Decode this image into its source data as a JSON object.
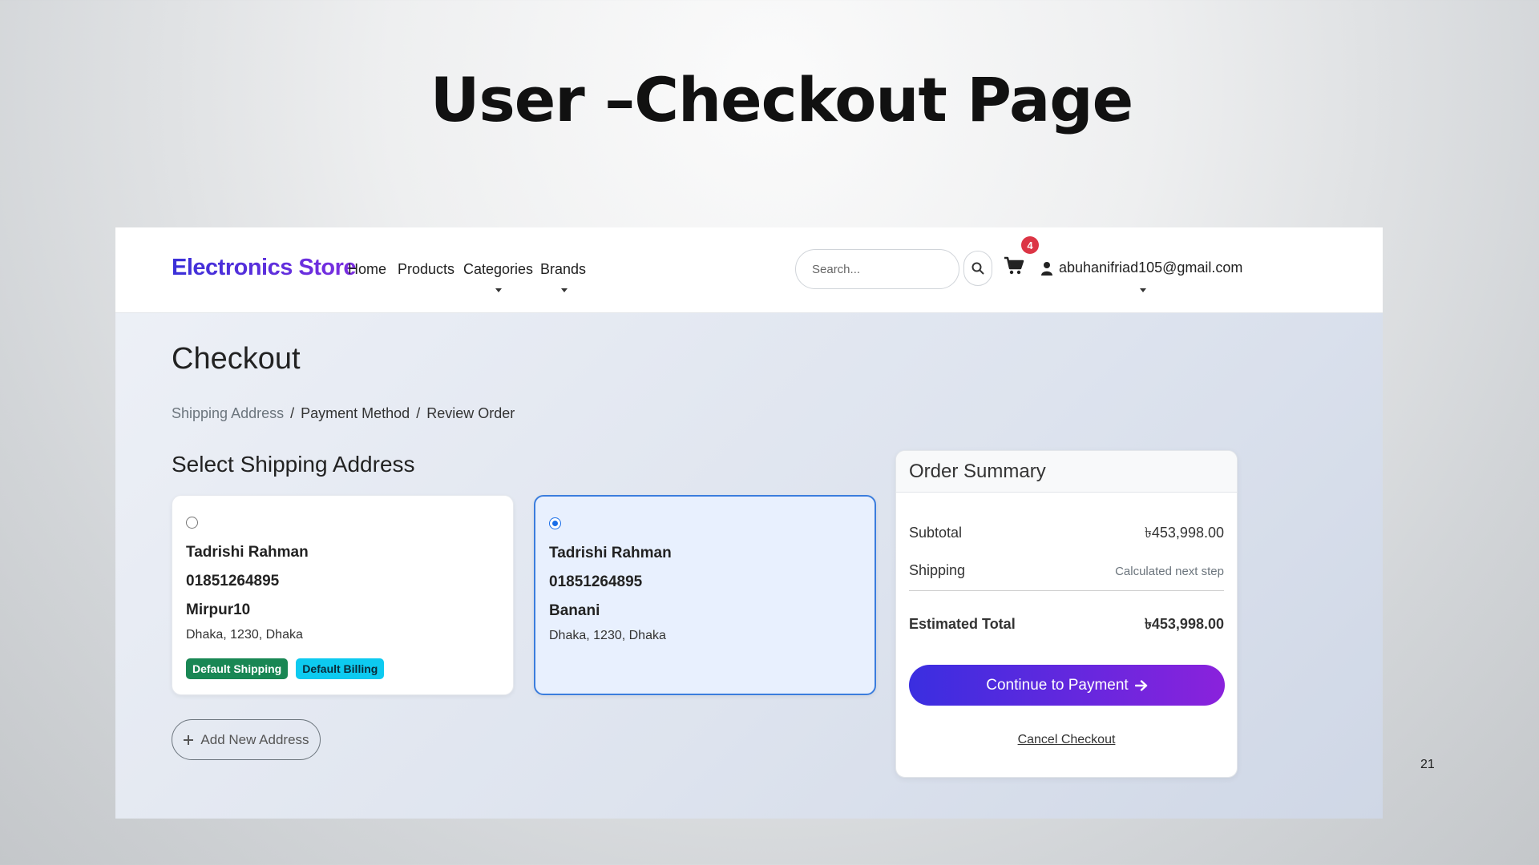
{
  "slide": {
    "title": "User –Checkout Page",
    "page_number": "21"
  },
  "navbar": {
    "brand": "Electronics Store",
    "links": [
      "Home",
      "Products",
      "Categories",
      "Brands"
    ],
    "search_placeholder": "Search...",
    "cart_count": "4",
    "user_email": "abuhanifriad105@gmail.com"
  },
  "checkout": {
    "heading": "Checkout",
    "breadcrumb": [
      "Shipping Address",
      "/",
      "Payment Method",
      "/",
      "Review Order"
    ],
    "section_title": "Select Shipping Address",
    "addresses": [
      {
        "name": "Tadrishi Rahman",
        "phone": "01851264895",
        "area": "Mirpur10",
        "city_line": "Dhaka, 1230, Dhaka",
        "selected": false,
        "badges": [
          "Default Shipping",
          "Default Billing"
        ]
      },
      {
        "name": "Tadrishi Rahman",
        "phone": "01851264895",
        "area": "Banani",
        "city_line": "Dhaka, 1230, Dhaka",
        "selected": true,
        "badges": []
      }
    ],
    "add_address_label": "Add New Address"
  },
  "summary": {
    "title": "Order Summary",
    "subtotal_label": "Subtotal",
    "subtotal_value": "৳453,998.00",
    "shipping_label": "Shipping",
    "shipping_value": "Calculated next step",
    "total_label": "Estimated Total",
    "total_value": "৳453,998.00",
    "pay_button": "Continue to Payment",
    "cancel_link": "Cancel Checkout"
  },
  "colors": {
    "brand_gradient_start": "#3a30d8",
    "brand_gradient_end": "#7c2ee0",
    "badge_red": "#dc3545",
    "badge_green": "#198754",
    "badge_cyan": "#0dcaf0",
    "selected_border": "#3b7ddd"
  },
  "icons": [
    "search-icon",
    "cart-icon",
    "user-icon",
    "plus-icon",
    "arrow-right-icon",
    "caret-down-icon"
  ]
}
